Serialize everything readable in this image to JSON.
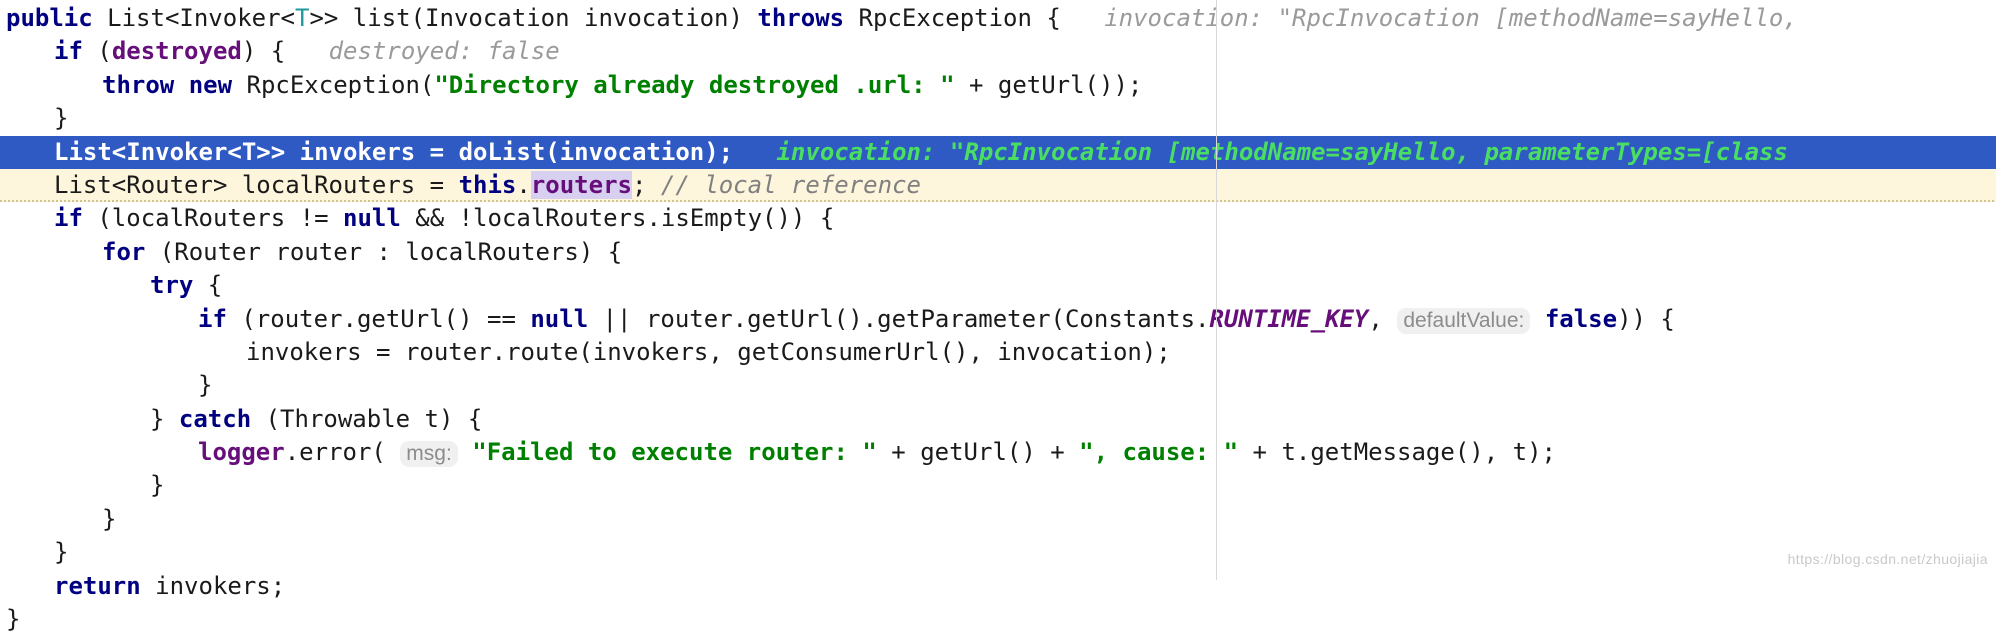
{
  "editor": {
    "language": "java",
    "font_size_px": 24,
    "margin_guide_x": 1216,
    "colors": {
      "background": "#ffffff",
      "selection": "#2f5ac4",
      "selection_text": "#ffffff",
      "selection_hint": "#4ade62",
      "execution_line": "#fdf6dd",
      "keyword": "#000080",
      "string": "#008000",
      "comment": "#808080",
      "field": "#660e7a",
      "static_constant": "#660e7a",
      "type_parameter": "#20999d",
      "inline_hint": "#9a9a9a",
      "identifier_highlight": "#d8d0f0",
      "margin_guide": "#d8d8d8",
      "watermark": "#c9c9c9"
    },
    "watermark": "https://blog.csdn.net/zhuojiajia"
  },
  "code": {
    "lines": [
      {
        "id": "line-1",
        "state": "normal",
        "indent": 0,
        "tokens": [
          {
            "t": "kw",
            "s": "public "
          },
          {
            "t": "plain",
            "s": "List<Invoker<"
          },
          {
            "t": "typeparam",
            "s": "T"
          },
          {
            "t": "plain",
            "s": ">> list(Invocation invocation) "
          },
          {
            "t": "kw",
            "s": "throws "
          },
          {
            "t": "plain",
            "s": "RpcException {"
          },
          {
            "t": "hint",
            "s": "   invocation: \"RpcInvocation [methodName=sayHello,"
          }
        ]
      },
      {
        "id": "line-2",
        "state": "normal",
        "indent": 1,
        "tokens": [
          {
            "t": "kw",
            "s": "if "
          },
          {
            "t": "plain",
            "s": "("
          },
          {
            "t": "field",
            "s": "destroyed"
          },
          {
            "t": "plain",
            "s": ") {"
          },
          {
            "t": "hint",
            "s": "   destroyed: false"
          }
        ]
      },
      {
        "id": "line-3",
        "state": "normal",
        "indent": 2,
        "tokens": [
          {
            "t": "kw",
            "s": "throw new "
          },
          {
            "t": "plain",
            "s": "RpcException("
          },
          {
            "t": "str",
            "s": "\"Directory already destroyed .url: \""
          },
          {
            "t": "plain",
            "s": " + getUrl());"
          }
        ]
      },
      {
        "id": "line-4",
        "state": "normal",
        "indent": 1,
        "tokens": [
          {
            "t": "plain",
            "s": "}"
          }
        ]
      },
      {
        "id": "line-5",
        "state": "selected",
        "indent": 1,
        "tokens": [
          {
            "t": "sel-w",
            "s": "List<Invoker<T>> invokers = doList(invocation);"
          },
          {
            "t": "sel-hint",
            "s": "   invocation: \"RpcInvocation [methodName=sayHello, parameterTypes=[class"
          }
        ]
      },
      {
        "id": "line-6",
        "state": "exec",
        "indent": 1,
        "tokens": [
          {
            "t": "plain",
            "s": "List<Router> localRouters = "
          },
          {
            "t": "kw",
            "s": "this"
          },
          {
            "t": "plain",
            "s": "."
          },
          {
            "t": "field ident-hl",
            "s": "routers"
          },
          {
            "t": "plain",
            "s": "; "
          },
          {
            "t": "cmt",
            "s": "// local reference"
          }
        ]
      },
      {
        "id": "line-7",
        "state": "normal",
        "indent": 1,
        "tokens": [
          {
            "t": "kw",
            "s": "if "
          },
          {
            "t": "plain",
            "s": "(localRouters != "
          },
          {
            "t": "kw",
            "s": "null "
          },
          {
            "t": "plain",
            "s": "&& !localRouters.isEmpty()) {"
          }
        ]
      },
      {
        "id": "line-8",
        "state": "normal",
        "indent": 2,
        "tokens": [
          {
            "t": "kw",
            "s": "for "
          },
          {
            "t": "plain",
            "s": "(Router router : localRouters) {"
          }
        ]
      },
      {
        "id": "line-9",
        "state": "normal",
        "indent": 3,
        "tokens": [
          {
            "t": "kw",
            "s": "try "
          },
          {
            "t": "plain",
            "s": "{"
          }
        ]
      },
      {
        "id": "line-10",
        "state": "normal",
        "indent": 4,
        "tokens": [
          {
            "t": "kw",
            "s": "if "
          },
          {
            "t": "plain",
            "s": "(router.getUrl() == "
          },
          {
            "t": "kw",
            "s": "null "
          },
          {
            "t": "plain",
            "s": "|| router.getUrl().getParameter(Constants."
          },
          {
            "t": "constant",
            "s": "RUNTIME_KEY"
          },
          {
            "t": "plain",
            "s": ", "
          },
          {
            "t": "chip",
            "s": "defaultValue:"
          },
          {
            "t": "plain",
            "s": " "
          },
          {
            "t": "kw",
            "s": "false"
          },
          {
            "t": "plain",
            "s": ")) {"
          }
        ]
      },
      {
        "id": "line-11",
        "state": "normal",
        "indent": 5,
        "tokens": [
          {
            "t": "plain",
            "s": "invokers = router.route(invokers, getConsumerUrl(), invocation);"
          }
        ]
      },
      {
        "id": "line-12",
        "state": "normal",
        "indent": 4,
        "tokens": [
          {
            "t": "plain",
            "s": "}"
          }
        ]
      },
      {
        "id": "line-13",
        "state": "normal",
        "indent": 3,
        "tokens": [
          {
            "t": "plain",
            "s": "} "
          },
          {
            "t": "kw",
            "s": "catch "
          },
          {
            "t": "plain",
            "s": "(Throwable t) {"
          }
        ]
      },
      {
        "id": "line-14",
        "state": "normal",
        "indent": 4,
        "tokens": [
          {
            "t": "field",
            "s": "logger"
          },
          {
            "t": "plain",
            "s": ".error( "
          },
          {
            "t": "chip",
            "s": "msg:"
          },
          {
            "t": "plain",
            "s": " "
          },
          {
            "t": "str",
            "s": "\"Failed to execute router: \""
          },
          {
            "t": "plain",
            "s": " + getUrl() + "
          },
          {
            "t": "str",
            "s": "\", cause: \""
          },
          {
            "t": "plain",
            "s": " + t.getMessage(), t);"
          }
        ]
      },
      {
        "id": "line-15",
        "state": "normal",
        "indent": 3,
        "tokens": [
          {
            "t": "plain",
            "s": "}"
          }
        ]
      },
      {
        "id": "line-16",
        "state": "normal",
        "indent": 2,
        "tokens": [
          {
            "t": "plain",
            "s": "}"
          }
        ]
      },
      {
        "id": "line-17",
        "state": "normal",
        "indent": 1,
        "tokens": [
          {
            "t": "plain",
            "s": "}"
          }
        ]
      },
      {
        "id": "line-18",
        "state": "normal",
        "indent": 1,
        "tokens": [
          {
            "t": "kw",
            "s": "return "
          },
          {
            "t": "plain",
            "s": "invokers;"
          }
        ]
      },
      {
        "id": "line-19",
        "state": "normal",
        "indent": 0,
        "tokens": [
          {
            "t": "plain",
            "s": "}"
          }
        ]
      }
    ]
  }
}
